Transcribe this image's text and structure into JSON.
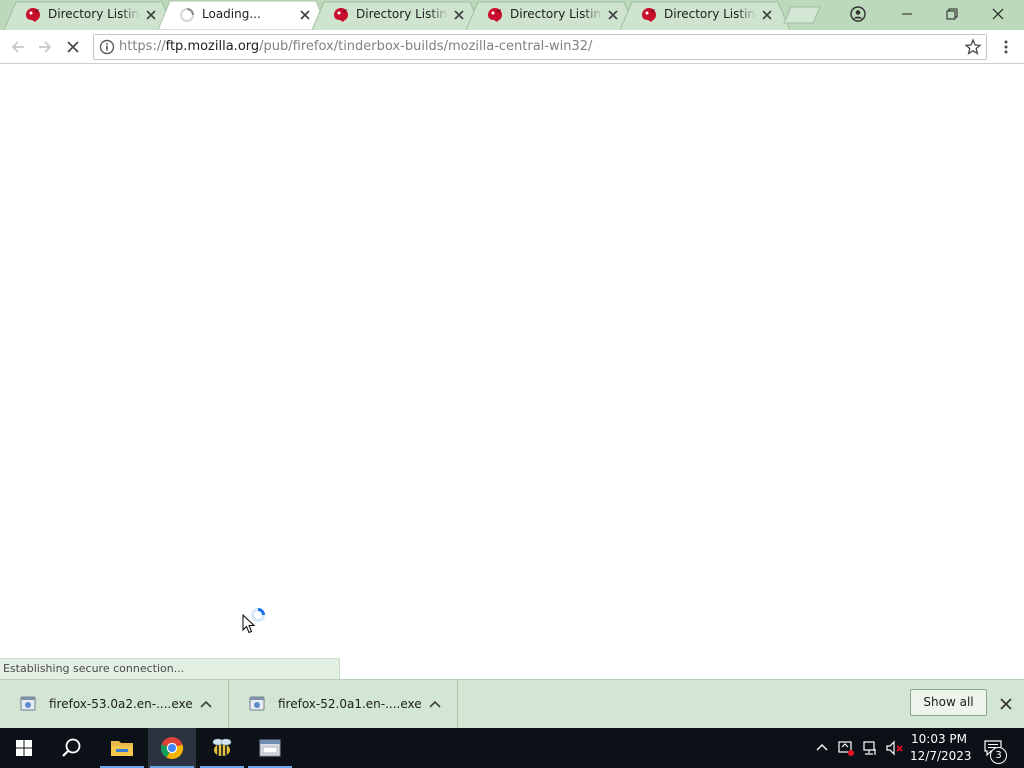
{
  "tabs": [
    {
      "title": "Directory Listing: /pub/firefox/tinderbox-builds/",
      "active": false,
      "loading": false
    },
    {
      "title": "Loading...",
      "active": true,
      "loading": true
    },
    {
      "title": "Directory Listing: /pub/firefox/",
      "active": false,
      "loading": false
    },
    {
      "title": "Directory Listing: /pub/",
      "active": false,
      "loading": false
    },
    {
      "title": "Directory Listing: /pub/firefox/tinderbox-builds/",
      "active": false,
      "loading": false
    }
  ],
  "address_bar": {
    "scheme": "https://",
    "host": "ftp.mozilla.org",
    "path": "/pub/firefox/tinderbox-builds/mozilla-central-win32/"
  },
  "status_text": "Establishing secure connection...",
  "downloads": [
    {
      "filename": "firefox-53.0a2.en-....exe"
    },
    {
      "filename": "firefox-52.0a1.en-....exe"
    }
  ],
  "show_all_label": "Show all",
  "clock": {
    "time": "10:03 PM",
    "date": "12/7/2023"
  },
  "notifications_count": "3",
  "colors": {
    "frame": "#bcd9bc",
    "active_tab": "#ffffff",
    "shelf": "#d3e6d3",
    "taskbar": "#0c1118",
    "accent": "#1a73e8"
  }
}
